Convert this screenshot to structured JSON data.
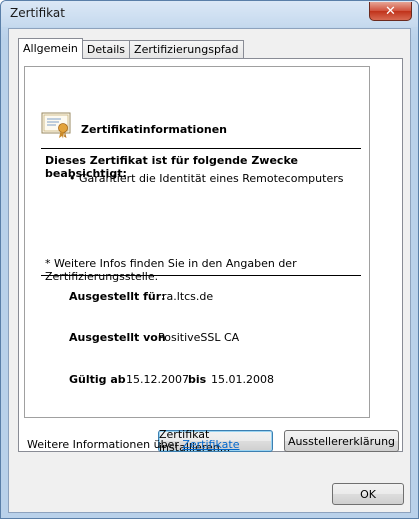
{
  "window": {
    "title": "Zertifikat",
    "close_label": "✕"
  },
  "tabs": [
    {
      "label": "Allgemein",
      "active": true
    },
    {
      "label": "Details",
      "active": false
    },
    {
      "label": "Zertifizierungspfad",
      "active": false
    }
  ],
  "certificate": {
    "heading": "Zertifikatinformationen",
    "purpose_heading": "Dieses Zertifikat ist für folgende Zwecke beabsichtigt:",
    "purposes": [
      "• Garantiert die Identität eines Remotecomputers"
    ],
    "footnote": "* Weitere Infos finden Sie in den Angaben der Zertifizierungsstelle.",
    "issued_to_label": "Ausgestellt für:",
    "issued_to_value": "ra.ltcs.de",
    "issued_by_label": "Ausgestellt von",
    "issued_by_value": "PositiveSSL CA",
    "valid_from_label": "Gültig ab",
    "valid_from_value": "15.12.2007",
    "valid_to_label": "bis",
    "valid_to_value": "15.01.2008"
  },
  "buttons": {
    "install": "Zertifikat installieren...",
    "issuer_statement": "Ausstellererklärung",
    "ok": "OK"
  },
  "more_info": {
    "text": "Weitere Informationen über ",
    "link": "Zertifikate"
  }
}
